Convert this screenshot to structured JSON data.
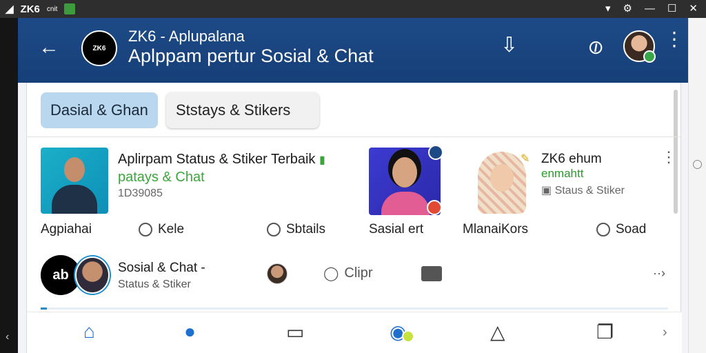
{
  "statusbar": {
    "app_name": "ZK6",
    "sub": "cnit"
  },
  "header": {
    "title": "ZK6 - Aplupalana",
    "subtitle": "Aplppam pertur Sosial & Chat",
    "logo_text": "ZK6"
  },
  "tabs": [
    {
      "label": "Dasial & Ghan"
    },
    {
      "label": "Ststays & Stikers"
    }
  ],
  "row1": {
    "title": "Aplirpam Status & Stiker Terbaik",
    "subtitle": "patays & Chat",
    "number": "1D39085",
    "actions": [
      {
        "label": "Agpiahai"
      },
      {
        "label": "Kele"
      },
      {
        "label": "Sbtails"
      }
    ]
  },
  "row2": {
    "caption": "Sasial ert"
  },
  "row3": {
    "title": "ZK6 ehum",
    "subtitle": "enmahtt",
    "meta": "Staus & Stiker",
    "actions": [
      {
        "label": "MlanaiKors"
      },
      {
        "label": "Soad"
      }
    ]
  },
  "row4": {
    "avatar_text": "ab",
    "title": "Sosial & Chat -",
    "subtitle": "Status & Stiker",
    "clip_label": "Clipr"
  },
  "progress": {
    "value": 0.01
  },
  "nav": [
    {
      "icon": "home-icon"
    },
    {
      "icon": "person-icon"
    },
    {
      "icon": "monitor-icon"
    },
    {
      "icon": "chat-icon"
    },
    {
      "icon": "bag-icon"
    },
    {
      "icon": "copy-icon"
    },
    {
      "icon": "chevron-right-icon"
    }
  ],
  "colors": {
    "header": "#1d4a86",
    "accent": "#1a8fd0",
    "green": "#3aa63a"
  }
}
